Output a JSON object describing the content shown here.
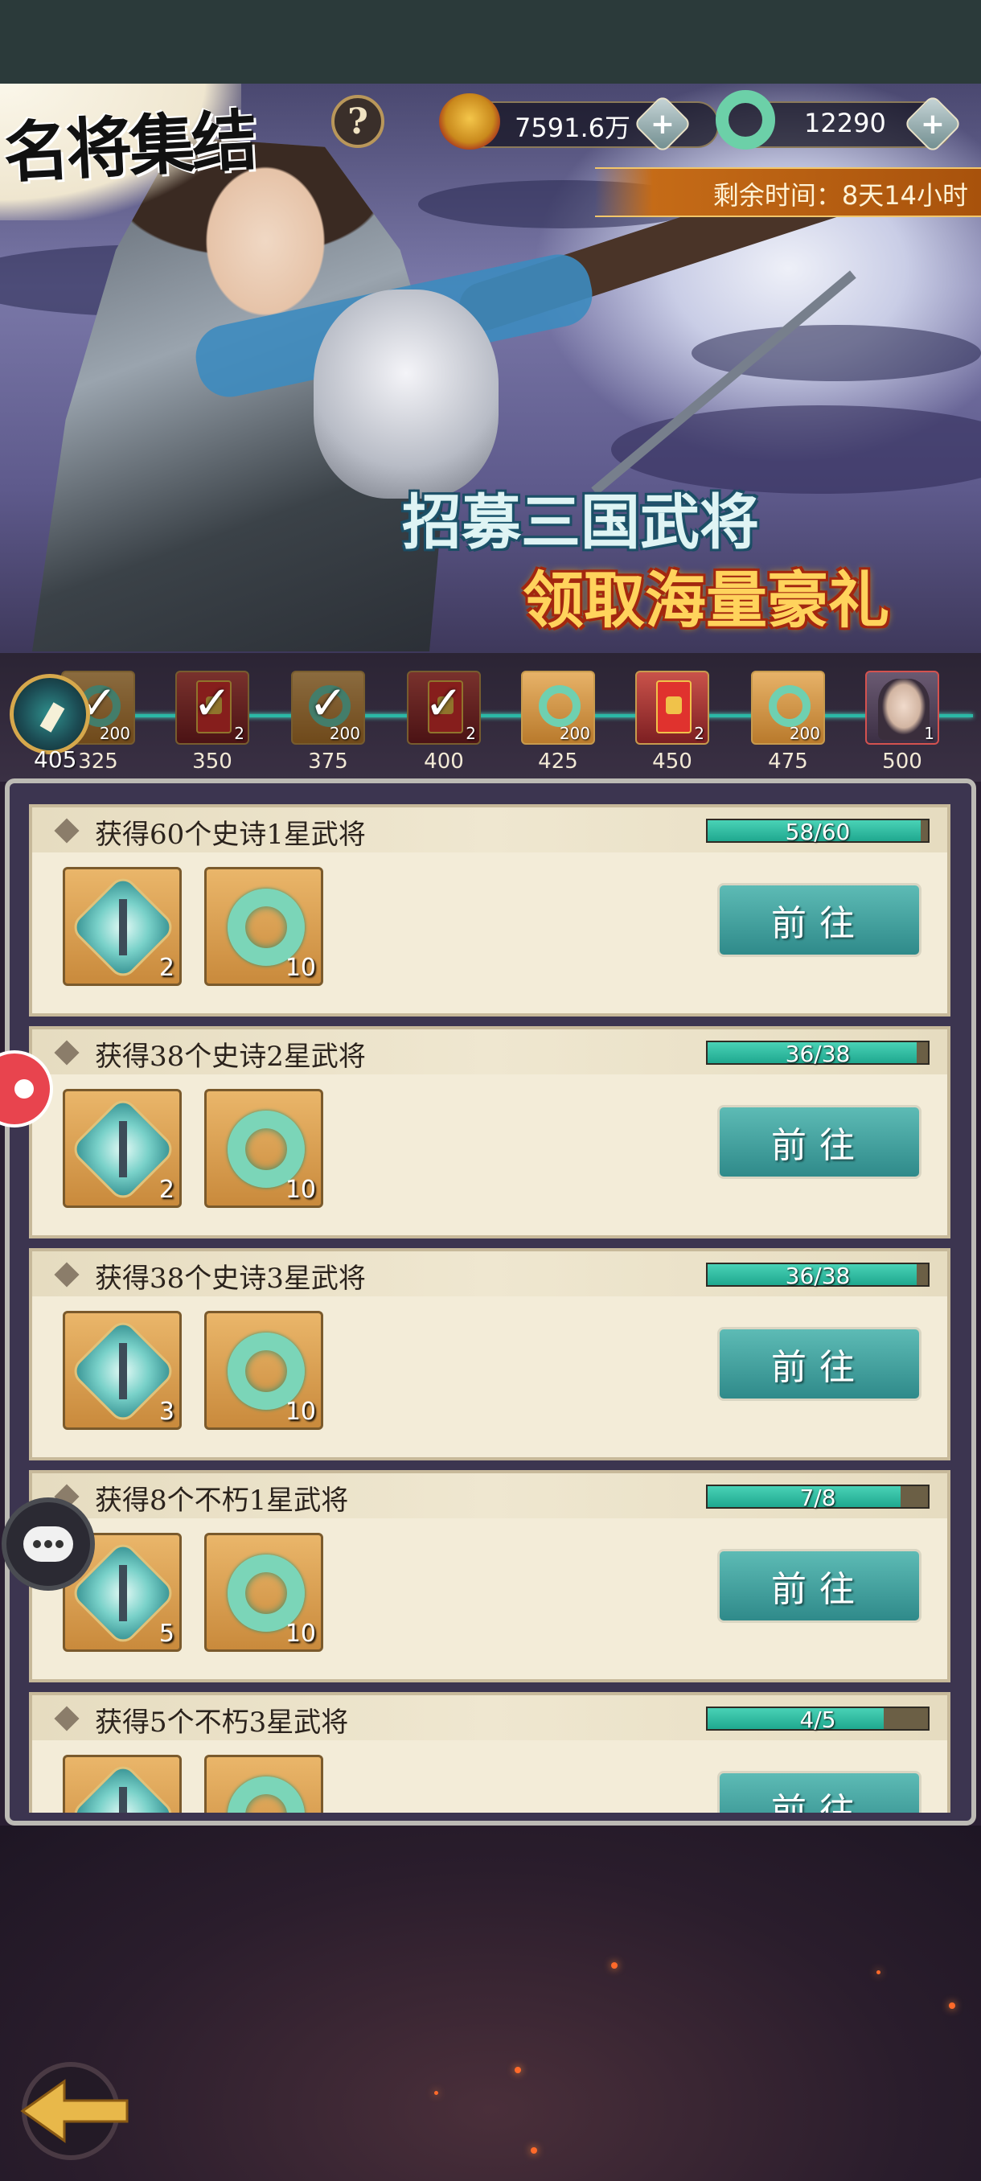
{
  "header": {
    "title": "名将集结",
    "help_label": "?",
    "currency_gold": "7591.6万",
    "currency_jade": "12290",
    "plus_label": "+",
    "remaining_time": "剩余时间：8天14小时"
  },
  "banner": {
    "slogan_line1": "招募三国武将",
    "slogan_line2": "领取海量豪礼"
  },
  "reward_track": {
    "current_score": "405",
    "nodes": [
      {
        "score": "325",
        "count": "200",
        "type": "jade",
        "claimed": true
      },
      {
        "score": "350",
        "count": "2",
        "type": "red-envelope",
        "claimed": true
      },
      {
        "score": "375",
        "count": "200",
        "type": "jade",
        "claimed": true
      },
      {
        "score": "400",
        "count": "2",
        "type": "red-envelope",
        "claimed": true
      },
      {
        "score": "425",
        "count": "200",
        "type": "jade",
        "claimed": false
      },
      {
        "score": "450",
        "count": "2",
        "type": "red-envelope",
        "claimed": false
      },
      {
        "score": "475",
        "count": "200",
        "type": "jade",
        "claimed": false
      },
      {
        "score": "500",
        "count": "1",
        "type": "general-portrait",
        "claimed": false
      }
    ]
  },
  "tasks": [
    {
      "title": "获得60个史诗1星武将",
      "progress_text": "58/60",
      "progress": 0.9667,
      "rewards": [
        {
          "type": "token",
          "count": "2"
        },
        {
          "type": "jade",
          "count": "10"
        }
      ],
      "button": "前往"
    },
    {
      "title": "获得38个史诗2星武将",
      "progress_text": "36/38",
      "progress": 0.9474,
      "rewards": [
        {
          "type": "token",
          "count": "2"
        },
        {
          "type": "jade",
          "count": "10"
        }
      ],
      "button": "前往"
    },
    {
      "title": "获得38个史诗3星武将",
      "progress_text": "36/38",
      "progress": 0.9474,
      "rewards": [
        {
          "type": "token",
          "count": "3"
        },
        {
          "type": "jade",
          "count": "10"
        }
      ],
      "button": "前往"
    },
    {
      "title": "获得8个不朽1星武将",
      "progress_text": "7/8",
      "progress": 0.875,
      "rewards": [
        {
          "type": "token",
          "count": "5"
        },
        {
          "type": "jade",
          "count": "10"
        }
      ],
      "button": "前往"
    },
    {
      "title": "获得5个不朽3星武将",
      "progress_text": "4/5",
      "progress": 0.8,
      "rewards": [
        {
          "type": "token",
          "count": ""
        },
        {
          "type": "jade",
          "count": ""
        }
      ],
      "button": "前往"
    }
  ],
  "colors": {
    "progress_fill": "#1fa88f",
    "go_button": "#2f8a8a",
    "time_banner": "#c56b17",
    "card_bg": "#f3ecd8"
  },
  "icons": {
    "back": "back-arrow-icon",
    "chat": "chat-bubble-icon",
    "help": "question-mark-icon",
    "gold": "coin-purse-icon",
    "jade": "jade-ring-icon"
  }
}
